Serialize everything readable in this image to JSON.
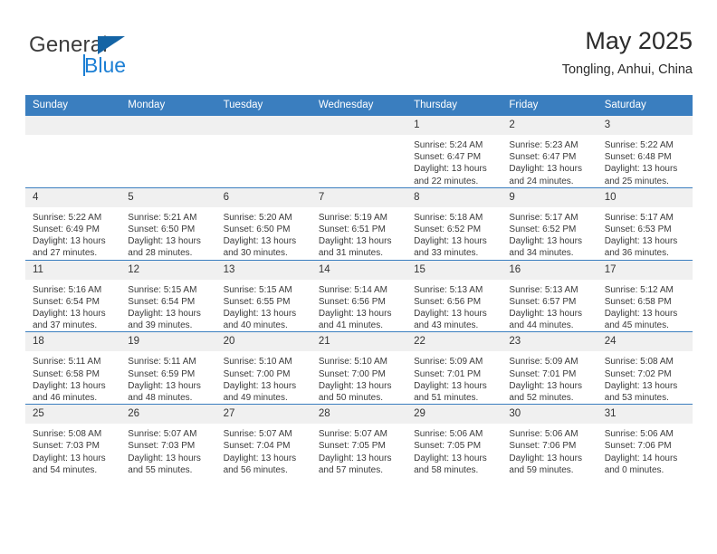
{
  "brand": {
    "name_primary": "General",
    "name_secondary": "Blue",
    "triangle_color": "#1464a5",
    "secondary_color": "#1c7fd4"
  },
  "header": {
    "title": "May 2025",
    "subtitle": "Tongling, Anhui, China"
  },
  "theme": {
    "header_blue": "#3a7ebf",
    "daynum_band": "#f0f0f0",
    "text": "#333333"
  },
  "calendar": {
    "weekday_headers": [
      "Sunday",
      "Monday",
      "Tuesday",
      "Wednesday",
      "Thursday",
      "Friday",
      "Saturday"
    ],
    "weeks": [
      [
        {
          "day": "",
          "sunrise": "",
          "sunset": "",
          "daylight": ""
        },
        {
          "day": "",
          "sunrise": "",
          "sunset": "",
          "daylight": ""
        },
        {
          "day": "",
          "sunrise": "",
          "sunset": "",
          "daylight": ""
        },
        {
          "day": "",
          "sunrise": "",
          "sunset": "",
          "daylight": ""
        },
        {
          "day": "1",
          "sunrise": "Sunrise: 5:24 AM",
          "sunset": "Sunset: 6:47 PM",
          "daylight": "Daylight: 13 hours and 22 minutes."
        },
        {
          "day": "2",
          "sunrise": "Sunrise: 5:23 AM",
          "sunset": "Sunset: 6:47 PM",
          "daylight": "Daylight: 13 hours and 24 minutes."
        },
        {
          "day": "3",
          "sunrise": "Sunrise: 5:22 AM",
          "sunset": "Sunset: 6:48 PM",
          "daylight": "Daylight: 13 hours and 25 minutes."
        }
      ],
      [
        {
          "day": "4",
          "sunrise": "Sunrise: 5:22 AM",
          "sunset": "Sunset: 6:49 PM",
          "daylight": "Daylight: 13 hours and 27 minutes."
        },
        {
          "day": "5",
          "sunrise": "Sunrise: 5:21 AM",
          "sunset": "Sunset: 6:50 PM",
          "daylight": "Daylight: 13 hours and 28 minutes."
        },
        {
          "day": "6",
          "sunrise": "Sunrise: 5:20 AM",
          "sunset": "Sunset: 6:50 PM",
          "daylight": "Daylight: 13 hours and 30 minutes."
        },
        {
          "day": "7",
          "sunrise": "Sunrise: 5:19 AM",
          "sunset": "Sunset: 6:51 PM",
          "daylight": "Daylight: 13 hours and 31 minutes."
        },
        {
          "day": "8",
          "sunrise": "Sunrise: 5:18 AM",
          "sunset": "Sunset: 6:52 PM",
          "daylight": "Daylight: 13 hours and 33 minutes."
        },
        {
          "day": "9",
          "sunrise": "Sunrise: 5:17 AM",
          "sunset": "Sunset: 6:52 PM",
          "daylight": "Daylight: 13 hours and 34 minutes."
        },
        {
          "day": "10",
          "sunrise": "Sunrise: 5:17 AM",
          "sunset": "Sunset: 6:53 PM",
          "daylight": "Daylight: 13 hours and 36 minutes."
        }
      ],
      [
        {
          "day": "11",
          "sunrise": "Sunrise: 5:16 AM",
          "sunset": "Sunset: 6:54 PM",
          "daylight": "Daylight: 13 hours and 37 minutes."
        },
        {
          "day": "12",
          "sunrise": "Sunrise: 5:15 AM",
          "sunset": "Sunset: 6:54 PM",
          "daylight": "Daylight: 13 hours and 39 minutes."
        },
        {
          "day": "13",
          "sunrise": "Sunrise: 5:15 AM",
          "sunset": "Sunset: 6:55 PM",
          "daylight": "Daylight: 13 hours and 40 minutes."
        },
        {
          "day": "14",
          "sunrise": "Sunrise: 5:14 AM",
          "sunset": "Sunset: 6:56 PM",
          "daylight": "Daylight: 13 hours and 41 minutes."
        },
        {
          "day": "15",
          "sunrise": "Sunrise: 5:13 AM",
          "sunset": "Sunset: 6:56 PM",
          "daylight": "Daylight: 13 hours and 43 minutes."
        },
        {
          "day": "16",
          "sunrise": "Sunrise: 5:13 AM",
          "sunset": "Sunset: 6:57 PM",
          "daylight": "Daylight: 13 hours and 44 minutes."
        },
        {
          "day": "17",
          "sunrise": "Sunrise: 5:12 AM",
          "sunset": "Sunset: 6:58 PM",
          "daylight": "Daylight: 13 hours and 45 minutes."
        }
      ],
      [
        {
          "day": "18",
          "sunrise": "Sunrise: 5:11 AM",
          "sunset": "Sunset: 6:58 PM",
          "daylight": "Daylight: 13 hours and 46 minutes."
        },
        {
          "day": "19",
          "sunrise": "Sunrise: 5:11 AM",
          "sunset": "Sunset: 6:59 PM",
          "daylight": "Daylight: 13 hours and 48 minutes."
        },
        {
          "day": "20",
          "sunrise": "Sunrise: 5:10 AM",
          "sunset": "Sunset: 7:00 PM",
          "daylight": "Daylight: 13 hours and 49 minutes."
        },
        {
          "day": "21",
          "sunrise": "Sunrise: 5:10 AM",
          "sunset": "Sunset: 7:00 PM",
          "daylight": "Daylight: 13 hours and 50 minutes."
        },
        {
          "day": "22",
          "sunrise": "Sunrise: 5:09 AM",
          "sunset": "Sunset: 7:01 PM",
          "daylight": "Daylight: 13 hours and 51 minutes."
        },
        {
          "day": "23",
          "sunrise": "Sunrise: 5:09 AM",
          "sunset": "Sunset: 7:01 PM",
          "daylight": "Daylight: 13 hours and 52 minutes."
        },
        {
          "day": "24",
          "sunrise": "Sunrise: 5:08 AM",
          "sunset": "Sunset: 7:02 PM",
          "daylight": "Daylight: 13 hours and 53 minutes."
        }
      ],
      [
        {
          "day": "25",
          "sunrise": "Sunrise: 5:08 AM",
          "sunset": "Sunset: 7:03 PM",
          "daylight": "Daylight: 13 hours and 54 minutes."
        },
        {
          "day": "26",
          "sunrise": "Sunrise: 5:07 AM",
          "sunset": "Sunset: 7:03 PM",
          "daylight": "Daylight: 13 hours and 55 minutes."
        },
        {
          "day": "27",
          "sunrise": "Sunrise: 5:07 AM",
          "sunset": "Sunset: 7:04 PM",
          "daylight": "Daylight: 13 hours and 56 minutes."
        },
        {
          "day": "28",
          "sunrise": "Sunrise: 5:07 AM",
          "sunset": "Sunset: 7:05 PM",
          "daylight": "Daylight: 13 hours and 57 minutes."
        },
        {
          "day": "29",
          "sunrise": "Sunrise: 5:06 AM",
          "sunset": "Sunset: 7:05 PM",
          "daylight": "Daylight: 13 hours and 58 minutes."
        },
        {
          "day": "30",
          "sunrise": "Sunrise: 5:06 AM",
          "sunset": "Sunset: 7:06 PM",
          "daylight": "Daylight: 13 hours and 59 minutes."
        },
        {
          "day": "31",
          "sunrise": "Sunrise: 5:06 AM",
          "sunset": "Sunset: 7:06 PM",
          "daylight": "Daylight: 14 hours and 0 minutes."
        }
      ]
    ]
  }
}
